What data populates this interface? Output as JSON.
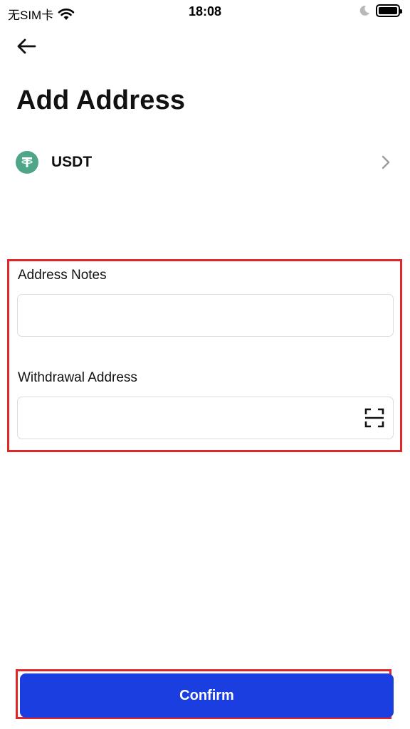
{
  "status_bar": {
    "carrier": "无SIM卡",
    "time": "18:08"
  },
  "header": {
    "title": "Add Address"
  },
  "coin": {
    "label": "USDT",
    "icon": "tether-icon",
    "icon_color": "#4fa587"
  },
  "form": {
    "address_notes": {
      "label": "Address Notes",
      "value": "",
      "placeholder": ""
    },
    "withdrawal_address": {
      "label": "Withdrawal Address",
      "value": "",
      "placeholder": ""
    }
  },
  "actions": {
    "confirm_label": "Confirm",
    "confirm_color": "#1a3ee0"
  },
  "annotation_color": "#e02727"
}
